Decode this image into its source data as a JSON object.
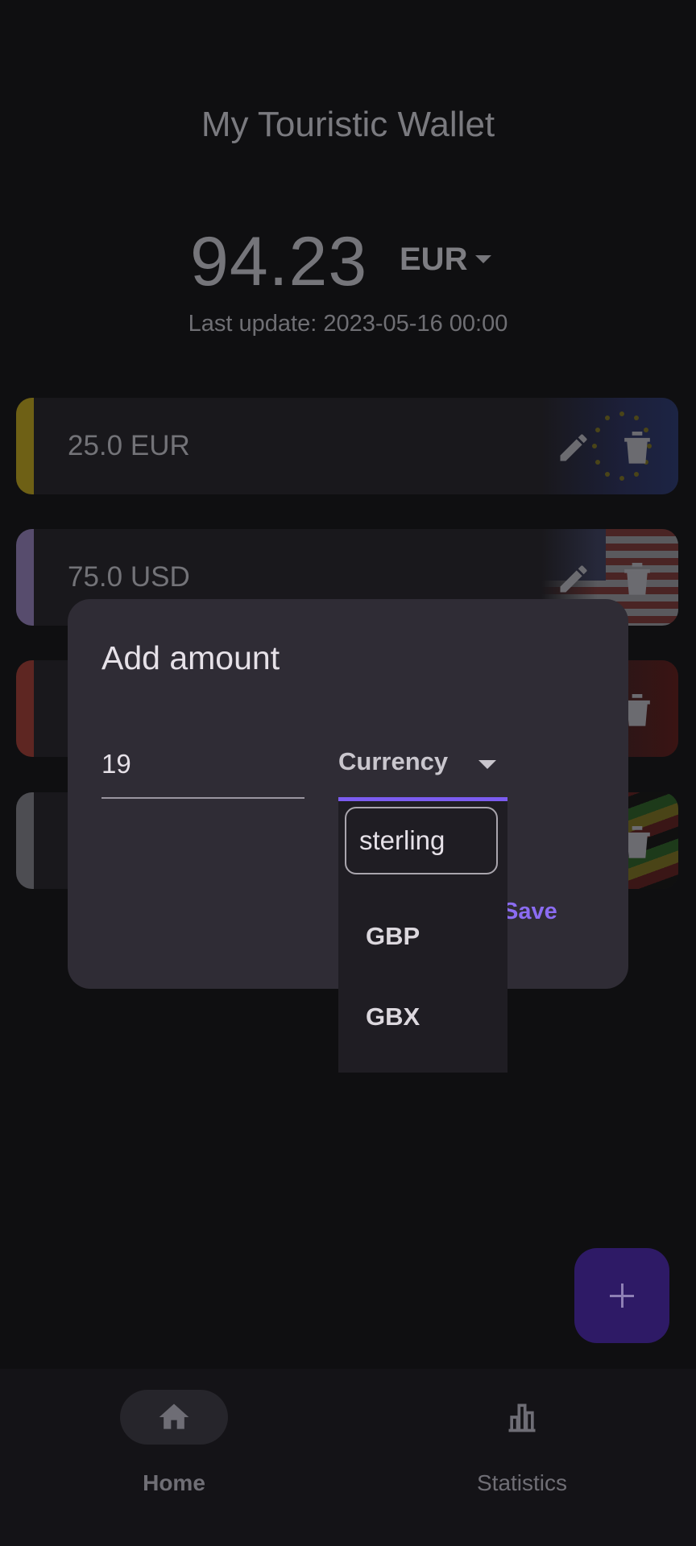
{
  "app": {
    "title": "My Touristic Wallet",
    "balance": "94.23",
    "balance_currency": "EUR",
    "last_update": "Last update: 2023-05-16 00:00"
  },
  "wallets": [
    {
      "amount": "25.0 EUR",
      "accent": "#7a6a12"
    },
    {
      "amount": "75.0 USD",
      "accent": "#5d4f74"
    },
    {
      "amount": "",
      "accent": "#6b2a25"
    },
    {
      "amount": "",
      "accent": "#55555a"
    }
  ],
  "dialog": {
    "title": "Add amount",
    "amount_value": "19",
    "currency_label": "Currency",
    "save_label": "Save"
  },
  "currency_menu": {
    "search_value": "sterling",
    "options": [
      "GBP",
      "GBX"
    ]
  },
  "nav": {
    "home_label": "Home",
    "statistics_label": "Statistics"
  },
  "colors": {
    "accent": "#7c5cf0",
    "dialog_bg": "#2f2c35",
    "fab_bg": "#2e1a66"
  }
}
